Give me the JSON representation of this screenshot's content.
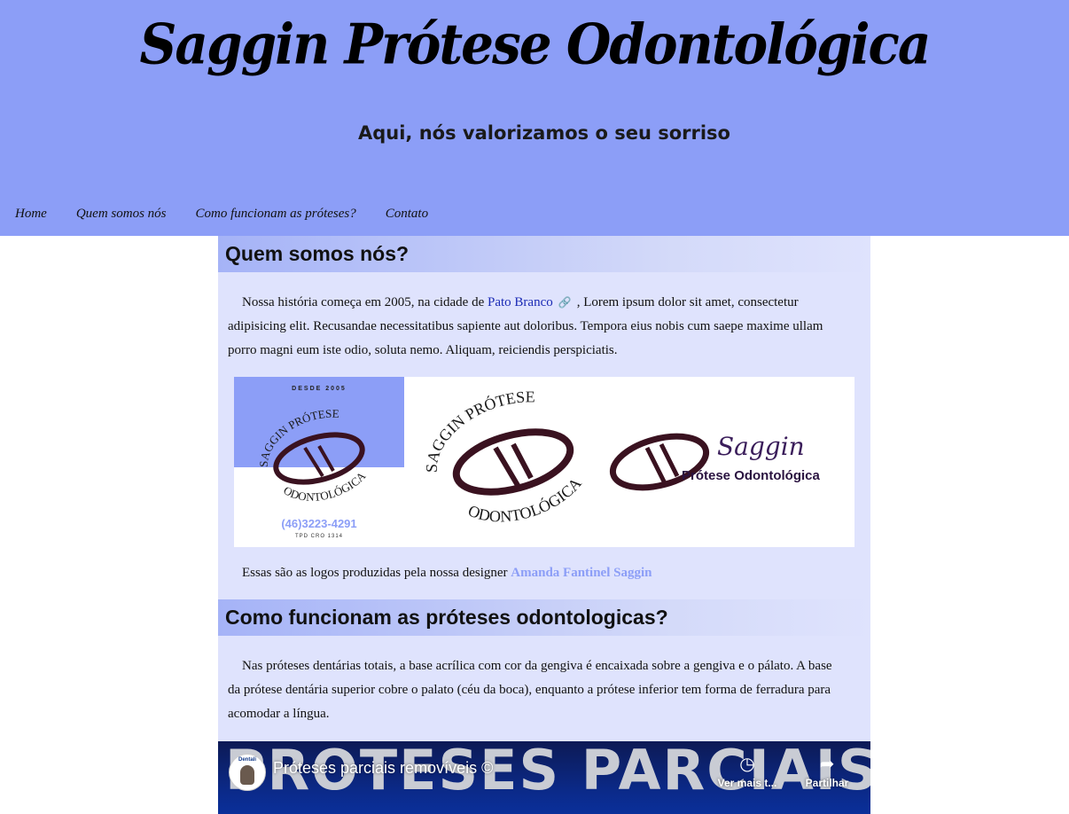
{
  "header": {
    "title": "Saggin Prótese Odontológica",
    "tagline": "Aqui, nós valorizamos o seu sorriso"
  },
  "nav": {
    "items": [
      "Home",
      "Quem somos nós",
      "Como funcionam as próteses?",
      "Contato"
    ]
  },
  "section1": {
    "heading": "Quem somos nós?",
    "para_before": "Nossa história começa em 2005, na cidade de ",
    "place_link": "Pato Branco",
    "para_after": ", Lorem ipsum dolor sit amet, consectetur adipisicing elit. Recusandae necessitatibus sapiente aut doloribus. Tempora eius nobis cum saepe maxime ullam porro magni eum iste odio, soluta nemo. Aliquam, reiciendis perspiciatis."
  },
  "logos": {
    "desde": "DESDE 2005",
    "brand_arc_top": "SAGGIN PRÓTESE",
    "brand_arc_bottom": "ODONTOLÓGICA",
    "phone": "(46)3223-4291",
    "tpd": "TPD CRO 1314",
    "saggin": "Saggin",
    "protese": "Prótese Odontológica"
  },
  "caption": {
    "text": "Essas são as logos produzidas pela nossa designer ",
    "designer": "Amanda Fantinel Saggin"
  },
  "section2": {
    "heading": "Como funcionam as próteses odontologicas?",
    "para": "Nas próteses dentárias totais, a base acrílica com cor da gengiva é encaixada sobre a gengiva e o pálato. A base da prótese dentária superior cobre o palato (céu da boca), enquanto a prótese inferior tem forma de ferradura para acomodar a língua."
  },
  "video": {
    "big_text": "PROTESES PARCIAIS",
    "channel": "Dentali",
    "title": "Próteses parciais removíveis ©",
    "watch_more": "Ver mais t...",
    "share": "Partilhar"
  }
}
